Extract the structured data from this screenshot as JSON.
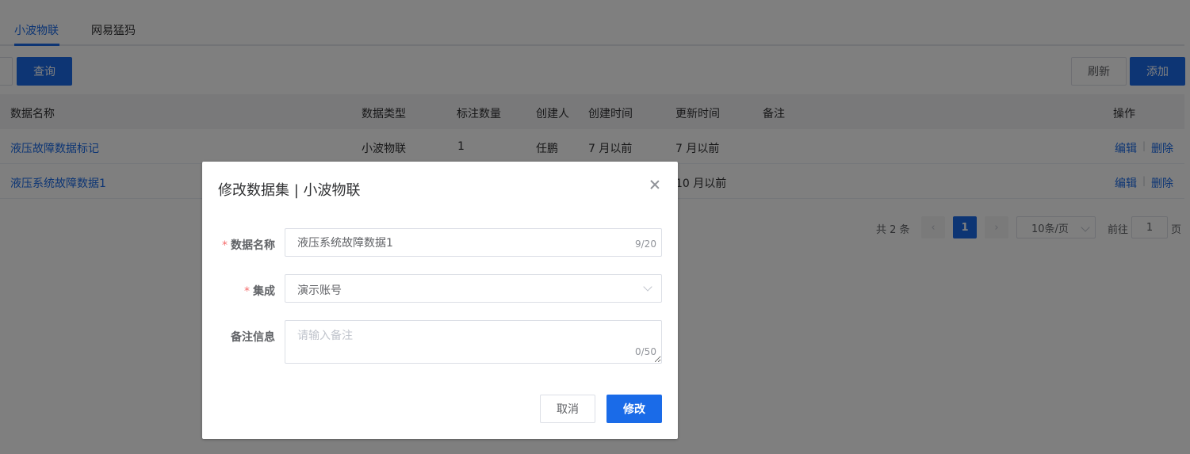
{
  "tabs": [
    {
      "label": "小波物联",
      "active": true
    },
    {
      "label": "网易猛犸",
      "active": false
    }
  ],
  "toolbar": {
    "query_label": "查询",
    "refresh_label": "刷新",
    "add_label": "添加"
  },
  "table": {
    "columns": [
      "数据名称",
      "数据类型",
      "标注数量",
      "创建人",
      "创建时间",
      "更新时间",
      "备注",
      "操作"
    ],
    "rows": [
      {
        "name": "液压故障数据标记",
        "type": "小波物联",
        "count": "1",
        "creator": "任鹏",
        "created": "7 月以前",
        "updated": "7 月以前",
        "note": ""
      },
      {
        "name": "液压系统故障数据1",
        "type": "",
        "count": "",
        "creator": "",
        "created": "",
        "updated": "10 月以前",
        "note": ""
      }
    ],
    "edit_label": "编辑",
    "delete_label": "删除"
  },
  "pagination": {
    "total_label": "共 2 条",
    "current_page": "1",
    "page_size_label": "10条/页",
    "goto_prefix": "前往",
    "goto_value": "1",
    "goto_suffix": "页"
  },
  "dialog": {
    "title": "修改数据集 | 小波物联",
    "fields": {
      "name_label": "数据名称",
      "name_value": "液压系统故障数据1",
      "name_count": "9/20",
      "integration_label": "集成",
      "integration_value": "演示账号",
      "remark_label": "备注信息",
      "remark_placeholder": "请输入备注",
      "remark_count": "0/50"
    },
    "cancel_label": "取消",
    "confirm_label": "修改"
  },
  "colors": {
    "primary": "#1a6be8",
    "required": "#f56c6c",
    "overlay": "rgba(0,0,0,0.5)"
  }
}
